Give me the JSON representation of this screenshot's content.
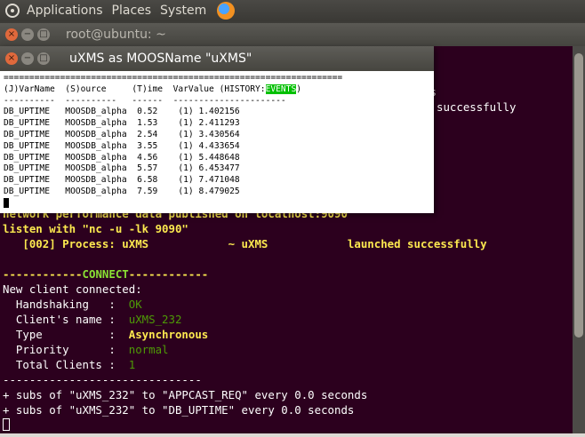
{
  "panel": {
    "menus": [
      "Applications",
      "Places",
      "System"
    ]
  },
  "back_window": {
    "title": "root@ubuntu: ~",
    "fragment_1": "es",
    "fragment_2": "successfully",
    "lines": {
      "network": "network performance data published on localhost:9090",
      "listen": "listen with \"nc -u -lk 9090\"",
      "process": "   [002] Process: uXMS            ~ uXMS            launched successfully",
      "connect_left": "------------",
      "connect_word": "CONNECT",
      "connect_right": "------------",
      "new_client": "New client connected:",
      "handshaking_label": "  Handshaking   :  ",
      "handshaking_value": "OK",
      "client_name_label": "  Client's name :  ",
      "client_name_value": "uXMS_232",
      "type_label": "  Type          :  ",
      "type_value": "Asynchronous",
      "priority_label": "  Priority      :  ",
      "priority_value": "normal",
      "total_label": "  Total Clients :  ",
      "total_value": "1",
      "separator": "------------------------------",
      "subs_1": "+ subs of \"uXMS_232\" to \"APPCAST_REQ\" every 0.0 seconds",
      "subs_2": "+ subs of \"uXMS_232\" to \"DB_UPTIME\" every 0.0 seconds"
    }
  },
  "front_window": {
    "title": "uXMS as MOOSName \"uXMS\"",
    "rule": "==================================================================",
    "header_prefix": "(J)VarName  (S)ource     (T)ime  VarValue (HISTORY:",
    "header_highlight": "EVENTS",
    "header_suffix": ")",
    "underline": "----------  ----------   ------  ----------------------",
    "rows": [
      "DB_UPTIME   MOOSDB_alpha  0.52    (1) 1.402156",
      "DB_UPTIME   MOOSDB_alpha  1.53    (1) 2.411293",
      "DB_UPTIME   MOOSDB_alpha  2.54    (1) 3.430564",
      "DB_UPTIME   MOOSDB_alpha  3.55    (1) 4.433654",
      "DB_UPTIME   MOOSDB_alpha  4.56    (1) 5.448648",
      "DB_UPTIME   MOOSDB_alpha  5.57    (1) 6.453477",
      "DB_UPTIME   MOOSDB_alpha  6.58    (1) 7.471048",
      "DB_UPTIME   MOOSDB_alpha  7.59    (1) 8.479025"
    ]
  }
}
